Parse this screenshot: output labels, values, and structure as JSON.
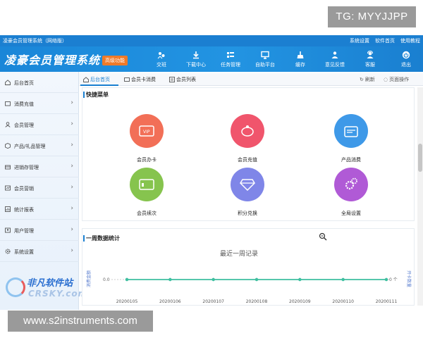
{
  "watermark_tag": "TG: MYYJJPP",
  "watermark_url": "www.s2instruments.com",
  "site_watermark": {
    "line1": "非凡软件站",
    "line2": "CRSKY.com"
  },
  "window": {
    "title": "凌豪会员管理系统（网络版）",
    "links": [
      "系统设置",
      "软件首页",
      "使用教程"
    ]
  },
  "banner": {
    "logo": "凌豪会员管理系统",
    "promo": "高级功能",
    "toolbar": [
      {
        "label": "交班",
        "icon": "handover-icon"
      },
      {
        "label": "下载中心",
        "icon": "download-icon"
      },
      {
        "label": "任务管理",
        "icon": "tasks-icon"
      },
      {
        "label": "自助平台",
        "icon": "monitor-icon"
      },
      {
        "label": "缓存",
        "icon": "broom-icon"
      },
      {
        "label": "意见反馈",
        "icon": "feedback-icon"
      },
      {
        "label": "客服",
        "icon": "support-icon"
      },
      {
        "label": "退出",
        "icon": "power-icon"
      }
    ]
  },
  "tabs": [
    {
      "label": "后台首页",
      "active": true
    },
    {
      "label": "会员卡消费",
      "active": false
    },
    {
      "label": "会员列表",
      "active": false
    }
  ],
  "tab_actions": {
    "refresh": "刷新",
    "page_ops": "页面操作"
  },
  "sidebar": {
    "items": [
      {
        "label": "后台首页",
        "icon": "home-icon"
      },
      {
        "label": "消费充值",
        "icon": "wallet-icon"
      },
      {
        "label": "会员管理",
        "icon": "user-icon"
      },
      {
        "label": "产品/礼品管理",
        "icon": "box-icon"
      },
      {
        "label": "进销存管理",
        "icon": "inventory-icon"
      },
      {
        "label": "会员营销",
        "icon": "marketing-icon"
      },
      {
        "label": "统计报表",
        "icon": "report-icon"
      },
      {
        "label": "用户管理",
        "icon": "users-icon"
      },
      {
        "label": "系统设置",
        "icon": "gear-icon"
      }
    ]
  },
  "quick_menu": {
    "title": "快捷菜单",
    "items": [
      {
        "label": "会员办卡",
        "color": "#f26f57",
        "icon": "vip-card-icon"
      },
      {
        "label": "会员充值",
        "color": "#f0556c",
        "icon": "piggy-bank-icon"
      },
      {
        "label": "产品消费",
        "color": "#3e99e8",
        "icon": "cash-register-icon"
      },
      {
        "label": "会员续次",
        "color": "#86c44e",
        "icon": "renew-card-icon"
      },
      {
        "label": "积分兑换",
        "color": "#7f86e8",
        "icon": "diamond-icon"
      },
      {
        "label": "全局设置",
        "color": "#b05ad6",
        "icon": "gears-icon"
      }
    ]
  },
  "stats": {
    "title": "一周数据统计",
    "chart_title": "最近一周记录",
    "left_axis_label": "消费金额",
    "right_axis_label": "开卡数量",
    "left_tick": "0.0",
    "right_tick": "0 个"
  },
  "chart_data": {
    "type": "line",
    "title": "最近一周记录",
    "categories": [
      "20200105",
      "20200106",
      "20200107",
      "20200108",
      "20200109",
      "20200110",
      "20200111"
    ],
    "series": [
      {
        "name": "消费金额",
        "values": [
          0,
          0,
          0,
          0,
          0,
          0,
          0
        ]
      },
      {
        "name": "开卡数量",
        "values": [
          0,
          0,
          0,
          0,
          0,
          0,
          0
        ]
      }
    ],
    "grid": false,
    "colors": {
      "line": "#3fbfa0"
    }
  }
}
